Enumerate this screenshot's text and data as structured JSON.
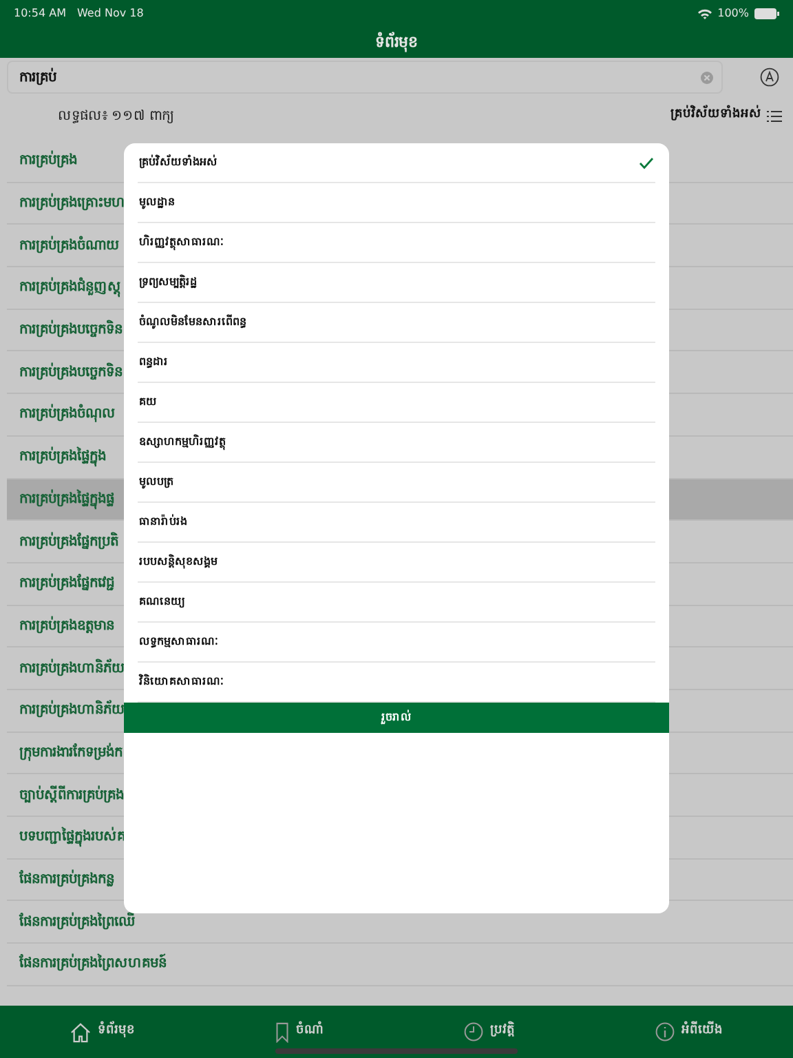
{
  "status_bar": {
    "time": "10:54 AM",
    "date": "Wed Nov 18",
    "battery": "100%"
  },
  "header": {
    "title": "ទំព័រមុខ"
  },
  "search": {
    "value": "ការគ្រប់"
  },
  "results": {
    "count": "លទ្ធផល៖ ១១៧ ពាក្យ",
    "filter": "គ្រប់វិស័យទាំងអស់"
  },
  "words": [
    {
      "text": "ការគ្រប់គ្រង",
      "selected": false
    },
    {
      "text": "ការគ្រប់គ្រងគ្រោះមហ",
      "selected": false
    },
    {
      "text": "ការគ្រប់គ្រងចំណាយ",
      "selected": false
    },
    {
      "text": "ការគ្រប់គ្រងជំនួញស្តុ",
      "selected": false
    },
    {
      "text": "ការគ្រប់គ្រងបច្ចេកទិន",
      "selected": false
    },
    {
      "text": "ការគ្រប់គ្រងបច្ចេកទិន",
      "selected": false
    },
    {
      "text": "ការគ្រប់គ្រងចំណុល",
      "selected": false
    },
    {
      "text": "ការគ្រប់គ្រងផ្ទៃក្នុង",
      "selected": false
    },
    {
      "text": "ការគ្រប់គ្រងផ្ទៃក្នុងផ្ទ",
      "selected": true
    },
    {
      "text": "ការគ្រប់គ្រងផ្នែកប្រតិ",
      "selected": false
    },
    {
      "text": "ការគ្រប់គ្រងផ្នែកវេជ្ជ",
      "selected": false
    },
    {
      "text": "ការគ្រប់គ្រងឧត្តមាន",
      "selected": false
    },
    {
      "text": "ការគ្រប់គ្រងហានិភ័យ",
      "selected": false
    },
    {
      "text": "ការគ្រប់គ្រងហានិភ័យ",
      "selected": false
    },
    {
      "text": "ក្រុមការងារកែទម្រង់ក",
      "selected": false
    },
    {
      "text": "ច្បាប់ស្តីពីការគ្រប់គ្រង",
      "selected": false
    },
    {
      "text": "បទបញ្ជាផ្ទៃក្នុងរបស់គ",
      "selected": false
    },
    {
      "text": "ផែនការគ្រប់គ្រងកន្ល",
      "selected": false
    },
    {
      "text": "ផែនការគ្រប់គ្រងព្រៃឈើ",
      "selected": false
    },
    {
      "text": "ផែនការគ្រប់គ្រងព្រៃសហគមន៍",
      "selected": false
    }
  ],
  "filter_dialog": {
    "options": [
      {
        "label": "គ្រប់វិស័យទាំងអស់",
        "selected": true
      },
      {
        "label": "មូលដ្ឋាន",
        "selected": false
      },
      {
        "label": "ហិរញ្ញវត្ថុសាធារណៈ",
        "selected": false
      },
      {
        "label": "ទ្រព្យសម្បត្តិរដ្ឋ",
        "selected": false
      },
      {
        "label": "ចំណូលមិនមែនសារពើពន្ធ",
        "selected": false
      },
      {
        "label": "ពន្ធដារ",
        "selected": false
      },
      {
        "label": "គយ",
        "selected": false
      },
      {
        "label": "ឧស្សាហកម្មហិរញ្ញវត្ថុ",
        "selected": false
      },
      {
        "label": "មូលបត្រ",
        "selected": false
      },
      {
        "label": "ធានារ៉ាប់រង",
        "selected": false
      },
      {
        "label": "របបសន្តិសុខសង្គម",
        "selected": false
      },
      {
        "label": "គណនេយ្យ",
        "selected": false
      },
      {
        "label": "លទ្ធកម្មសាធារណៈ",
        "selected": false
      },
      {
        "label": "វិនិយោគសាធារណៈ",
        "selected": false
      }
    ],
    "done_button": "រួចរាល់"
  },
  "tab_bar": [
    {
      "kind": "home",
      "label": "ទំព័រមុខ"
    },
    {
      "kind": "bookmark",
      "label": "ចំណាំ"
    },
    {
      "kind": "history",
      "label": "ប្រវត្តិ"
    },
    {
      "kind": "info",
      "label": "អំពីយើង"
    }
  ]
}
